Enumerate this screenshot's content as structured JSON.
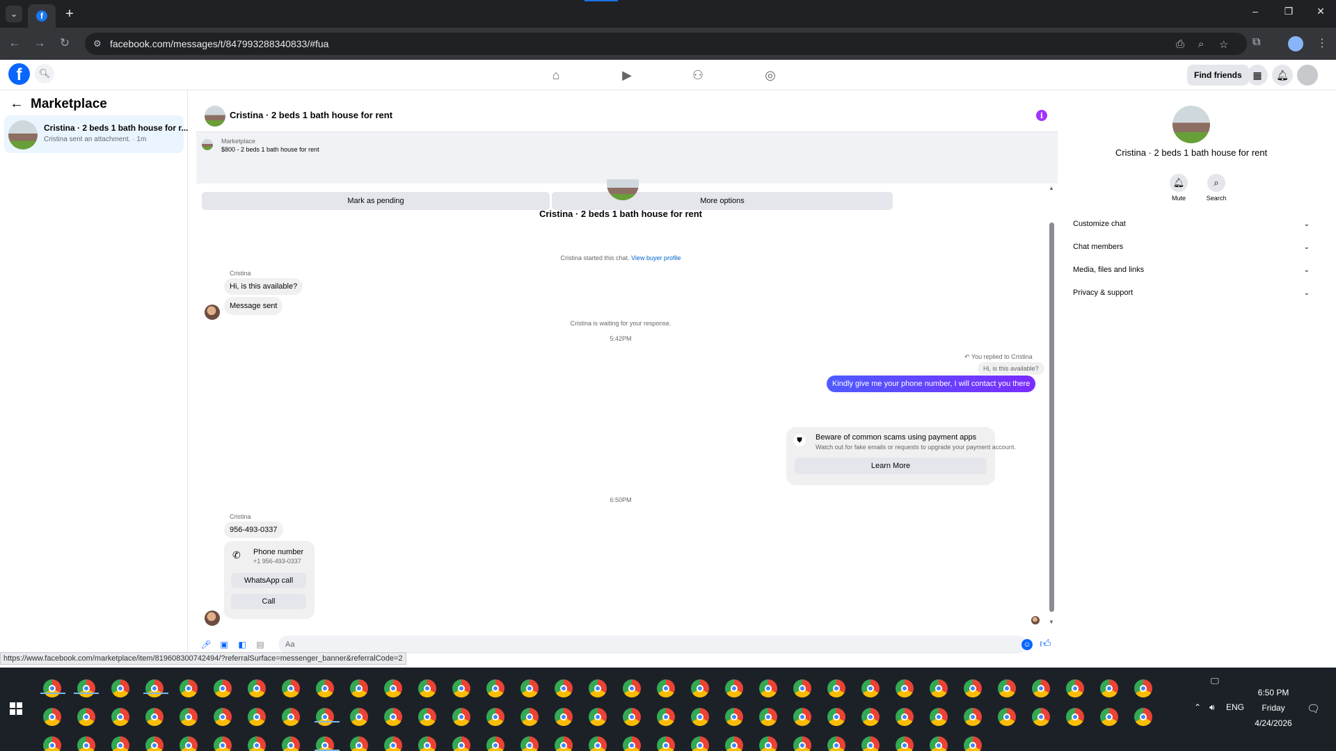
{
  "browser": {
    "url": "facebook.com/messages/t/847993288340833/#fua",
    "status_url": "https://www.facebook.com/marketplace/item/819608300742494/?referralSurface=messenger_banner&referralCode=2"
  },
  "fb_nav": {
    "find_friends": "Find friends"
  },
  "sidebar": {
    "title": "Marketplace",
    "conversation": {
      "title": "Cristina · 2 beds 1 bath house for r...",
      "subtitle": "Cristina sent an attachment. · 1m"
    }
  },
  "chat": {
    "header_title": "Cristina · 2 beds 1 bath house for rent",
    "banner_label": "Marketplace",
    "banner_listing": "$800 - 2 beds 1 bath house for rent",
    "mark_pending": "Mark as pending",
    "more_options": "More options",
    "top_name": "Cristina · 2 beds 1 bath house for rent",
    "started_text": "Cristina started this chat.",
    "view_buyer_profile": "View buyer profile",
    "sender_name": "Cristina",
    "msg1": "Hi, is this available?",
    "msg2": "Message sent",
    "waiting_text": "Cristina is waiting for your response.",
    "time1": "5:42PM",
    "replied_note": "You replied to Cristina",
    "quoted": "Hi, is this available?",
    "my_msg": "Kindly give me your phone number, I will contact you there",
    "warn_title": "Beware of common scams using payment apps",
    "warn_sub": "Watch out for fake emails or requests to upgrade your payment account.",
    "learn_more": "Learn More",
    "time2": "6:50PM",
    "sender_name2": "Cristina",
    "phone_msg": "956-493-0337",
    "phone_card_title": "Phone number",
    "phone_card_number": "+1 956-493-0337",
    "whatsapp_call": "WhatsApp call",
    "call": "Call",
    "composer_placeholder": "Aa"
  },
  "right_panel": {
    "title": "Cristina · 2 beds 1 bath house for rent",
    "mute": "Mute",
    "search": "Search",
    "sections": [
      "Customize chat",
      "Chat members",
      "Media, files and links",
      "Privacy & support"
    ]
  },
  "taskbar": {
    "lang": "ENG",
    "time": "6:50 PM",
    "day": "Friday",
    "date": "4/24/2026"
  }
}
